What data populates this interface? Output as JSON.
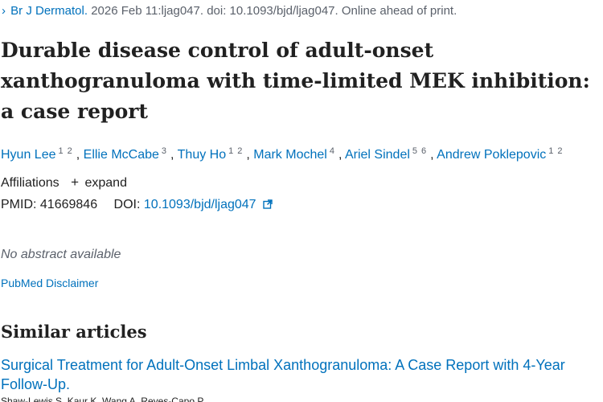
{
  "citation": {
    "journal": "Br J Dermatol.",
    "details": " 2026 Feb 11:ljag047. doi: 10.1093/bjd/ljag047. Online ahead of print."
  },
  "title": "Durable disease control of adult-onset xanthogranuloma with time-limited MEK inhibition: a case report",
  "authors": [
    {
      "name": "Hyun Lee",
      "affils": [
        "1",
        "2"
      ],
      "sep": ", "
    },
    {
      "name": "Ellie McCabe",
      "affils": [
        "3"
      ],
      "sep": ", "
    },
    {
      "name": "Thuy Ho",
      "affils": [
        "1",
        "2"
      ],
      "sep": ", "
    },
    {
      "name": "Mark Mochel",
      "affils": [
        "4"
      ],
      "sep": ", "
    },
    {
      "name": "Ariel Sindel",
      "affils": [
        "5",
        "6"
      ],
      "sep": ", "
    },
    {
      "name": "Andrew Poklepovic",
      "affils": [
        "1",
        "2"
      ],
      "sep": ""
    }
  ],
  "affiliations": {
    "label": "Affiliations",
    "toggle_icon": "+",
    "toggle_label": "expand"
  },
  "ids": {
    "pmid_label": "PMID:",
    "pmid": "41669846",
    "doi_label": "DOI:",
    "doi": "10.1093/bjd/ljag047"
  },
  "abstract_note": "No abstract available",
  "disclaimer_link": "PubMed Disclaimer",
  "similar": {
    "heading": "Similar articles",
    "first_title": "Surgical Treatment for Adult-Onset Limbal Xanthogranuloma: A Case Report with 4-Year Follow-Up.",
    "first_authors_cut": "Shaw-Lewis S, Kaur K, Wang A, Reyes-Capo P."
  },
  "colors": {
    "link": "#0071bc",
    "muted": "#5b616b",
    "text": "#212121"
  },
  "icons": {
    "citation_chevron": "chevron-right-icon",
    "doi_external": "external-link-icon"
  }
}
